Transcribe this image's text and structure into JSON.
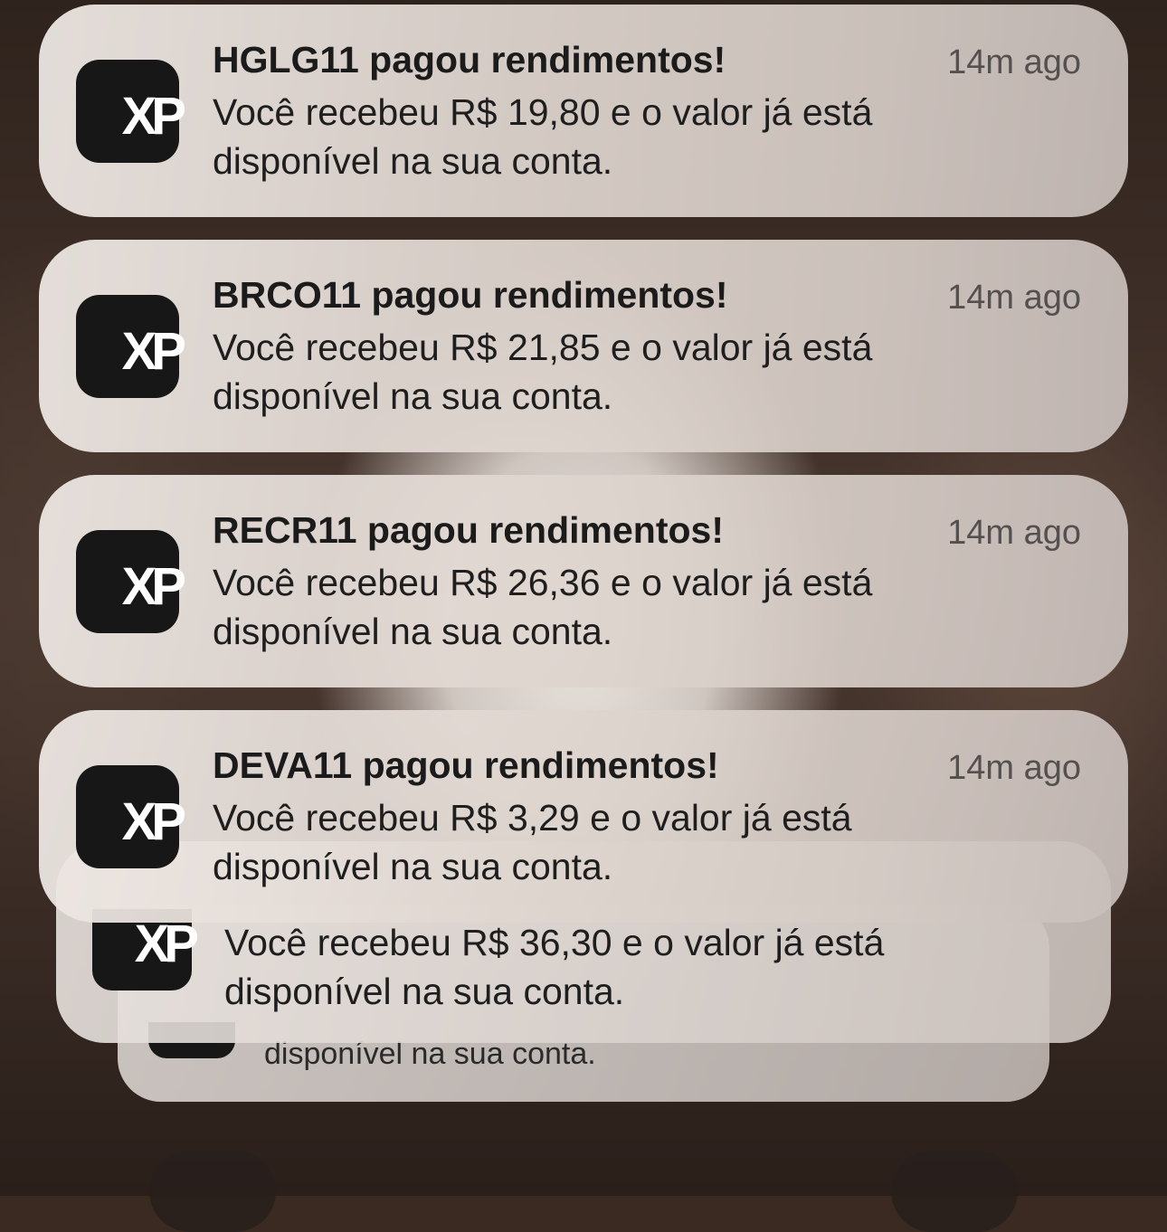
{
  "notifications": [
    {
      "title": "HGLG11 pagou rendimentos!",
      "time": "14m ago",
      "message": "Você recebeu R$ 19,80 e o valor já está disponível na sua conta."
    },
    {
      "title": "BRCO11 pagou rendimentos!",
      "time": "14m ago",
      "message": "Você recebeu R$ 21,85 e o valor já está disponível na sua conta."
    },
    {
      "title": "RECR11 pagou rendimentos!",
      "time": "14m ago",
      "message": "Você recebeu R$ 26,36 e o valor já está disponível na sua conta."
    },
    {
      "title": "DEVA11 pagou rendimentos!",
      "time": "14m ago",
      "message": "Você recebeu R$ 3,29 e o valor já está disponível na sua conta."
    }
  ],
  "stacked": [
    {
      "message": "Você recebeu R$ 36,30 e o valor já está disponível na sua conta."
    },
    {
      "message": "disponível na sua conta."
    }
  ],
  "app": {
    "logo_text": "XP",
    "icon": "xp-app-icon",
    "icon_bg": "#171717"
  }
}
